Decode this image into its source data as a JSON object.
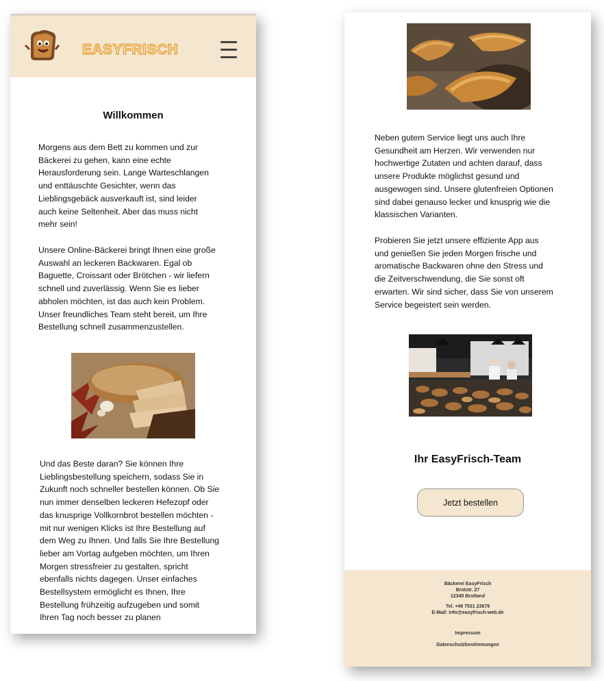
{
  "header": {
    "brand": "EASYFRISCH",
    "menu_icon": "hamburger-menu-icon",
    "logo_icon": "toast-mascot-icon"
  },
  "colors": {
    "header_bg": "#f5e6cf",
    "brand_fill": "#f6e3c6",
    "brand_stroke": "#e8a33a"
  },
  "left": {
    "title": "Willkommen",
    "p1": [
      "Morgens aus dem Bett zu kommen und zur",
      "Bäckerei zu gehen, kann eine echte",
      "Herausforderung sein. Lange Warteschlangen",
      "und enttäuschte Gesichter, wenn das",
      "Lieblingsgebäck ausverkauft ist, sind leider",
      "auch keine Seltenheit. Aber das muss nicht",
      "mehr sein!"
    ],
    "p2": [
      "Unsere Online-Bäckerei bringt Ihnen eine große",
      "Auswahl an leckeren Backwaren. Egal ob",
      "Baguette, Croissant oder Brötchen - wir liefern",
      "schnell und zuverlässig. Wenn Sie es lieber",
      "abholen möchten, ist das auch kein Problem.",
      "Unser freundliches Team steht bereit, um Ihre",
      "Bestellung schnell zusammenzustellen."
    ],
    "p3": [
      "Und das Beste daran? Sie können Ihre",
      "Lieblingsbestellung speichern, sodass Sie in",
      "Zukunft noch schneller bestellen können. Ob Sie",
      "nun immer denselben leckeren Hefezopf oder",
      "das knusprige Vollkornbrot bestellen möchten -",
      "mit nur wenigen Klicks ist Ihre Bestellung auf",
      "dem Weg zu Ihnen. Und falls Sie Ihre Bestellung",
      "lieber am Vortag aufgeben möchten, um Ihren",
      "Morgen stressfreier zu gestalten, spricht",
      "ebenfalls nichts dagegen. Unser einfaches",
      "Bestellsystem ermöglicht es Ihnen, Ihre",
      "Bestellung frühzeitig aufzugeben und somit",
      "Ihren Tag noch besser zu planen"
    ]
  },
  "right": {
    "p1": [
      "Neben gutem Service liegt uns auch Ihre",
      "Gesundheit am Herzen. Wir verwenden nur",
      "hochwertige Zutaten und achten darauf, dass",
      "unsere Produkte möglichst gesund und",
      "ausgewogen sind. Unsere glutenfreien Optionen",
      "sind dabei genauso lecker und knusprig wie die",
      "klassischen Varianten."
    ],
    "p2": [
      "Probieren Sie jetzt unsere effiziente App aus",
      "und genießen Sie jeden Morgen frische und",
      "aromatische Backwaren ohne den Stress und",
      "die Zeitverschwendung, die Sie sonst oft",
      "erwarten. Wir sind sicher, dass Sie von unserem",
      "Service begeistert sein werden."
    ],
    "team": "Ihr EasyFrisch-Team",
    "order_button": "Jetzt bestellen"
  },
  "footer": {
    "company": "Bäckerei EasyFrisch",
    "street": "Brotstr. 27",
    "city": "12345 Brotland",
    "phone": "Tel. +49 7531 23679",
    "email": "E-Mail: info@easyfrisch-web.de",
    "impressum": "Impressum",
    "privacy": "Datenschutzbestimmungen"
  }
}
